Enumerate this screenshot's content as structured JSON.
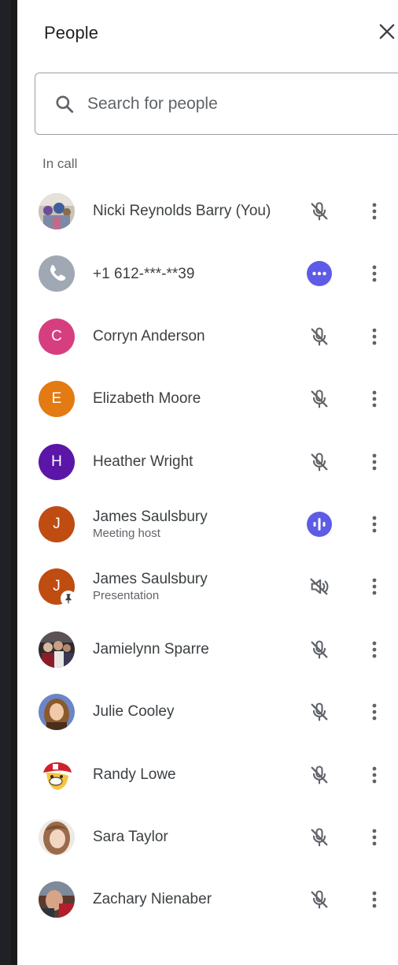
{
  "panel": {
    "title": "People",
    "close_icon": "close-icon"
  },
  "search": {
    "placeholder": "Search for people",
    "icon": "search-icon"
  },
  "section": {
    "label": "In call"
  },
  "colors": {
    "accent_blue": "#5e5ce6",
    "avatar_pink": "#d63e80",
    "avatar_orange": "#e37a12",
    "avatar_purple": "#5b16a8",
    "avatar_rust": "#bf4c10",
    "phone_gray": "#a0a8b3",
    "icon_gray": "#5f6368"
  },
  "participants": [
    {
      "name": "Nicki Reynolds Barry (You)",
      "subtitle": "",
      "avatar": "photo",
      "status": "mic-off-icon"
    },
    {
      "name": "+1 612-***-**39",
      "subtitle": "",
      "avatar": "phone-icon",
      "status": "more-options-badge-icon"
    },
    {
      "name": "Corryn Anderson",
      "subtitle": "",
      "avatar_letter": "C",
      "status": "mic-off-icon"
    },
    {
      "name": "Elizabeth Moore",
      "subtitle": "",
      "avatar_letter": "E",
      "status": "mic-off-icon"
    },
    {
      "name": "Heather Wright",
      "subtitle": "",
      "avatar_letter": "H",
      "status": "mic-off-icon"
    },
    {
      "name": "James Saulsbury",
      "subtitle": "Meeting host",
      "avatar_letter": "J",
      "status": "audio-level-icon"
    },
    {
      "name": "James Saulsbury",
      "subtitle": "Presentation",
      "avatar_letter": "J",
      "status": "volume-off-icon"
    },
    {
      "name": "Jamielynn Sparre",
      "subtitle": "",
      "avatar": "photo",
      "status": "mic-off-icon"
    },
    {
      "name": "Julie Cooley",
      "subtitle": "",
      "avatar": "photo",
      "status": "mic-off-icon"
    },
    {
      "name": "Randy Lowe",
      "subtitle": "",
      "avatar": "photo",
      "status": "mic-off-icon"
    },
    {
      "name": "Sara Taylor",
      "subtitle": "",
      "avatar": "photo",
      "status": "mic-off-icon"
    },
    {
      "name": "Zachary Nienaber",
      "subtitle": "",
      "avatar": "photo",
      "status": "mic-off-icon"
    }
  ]
}
